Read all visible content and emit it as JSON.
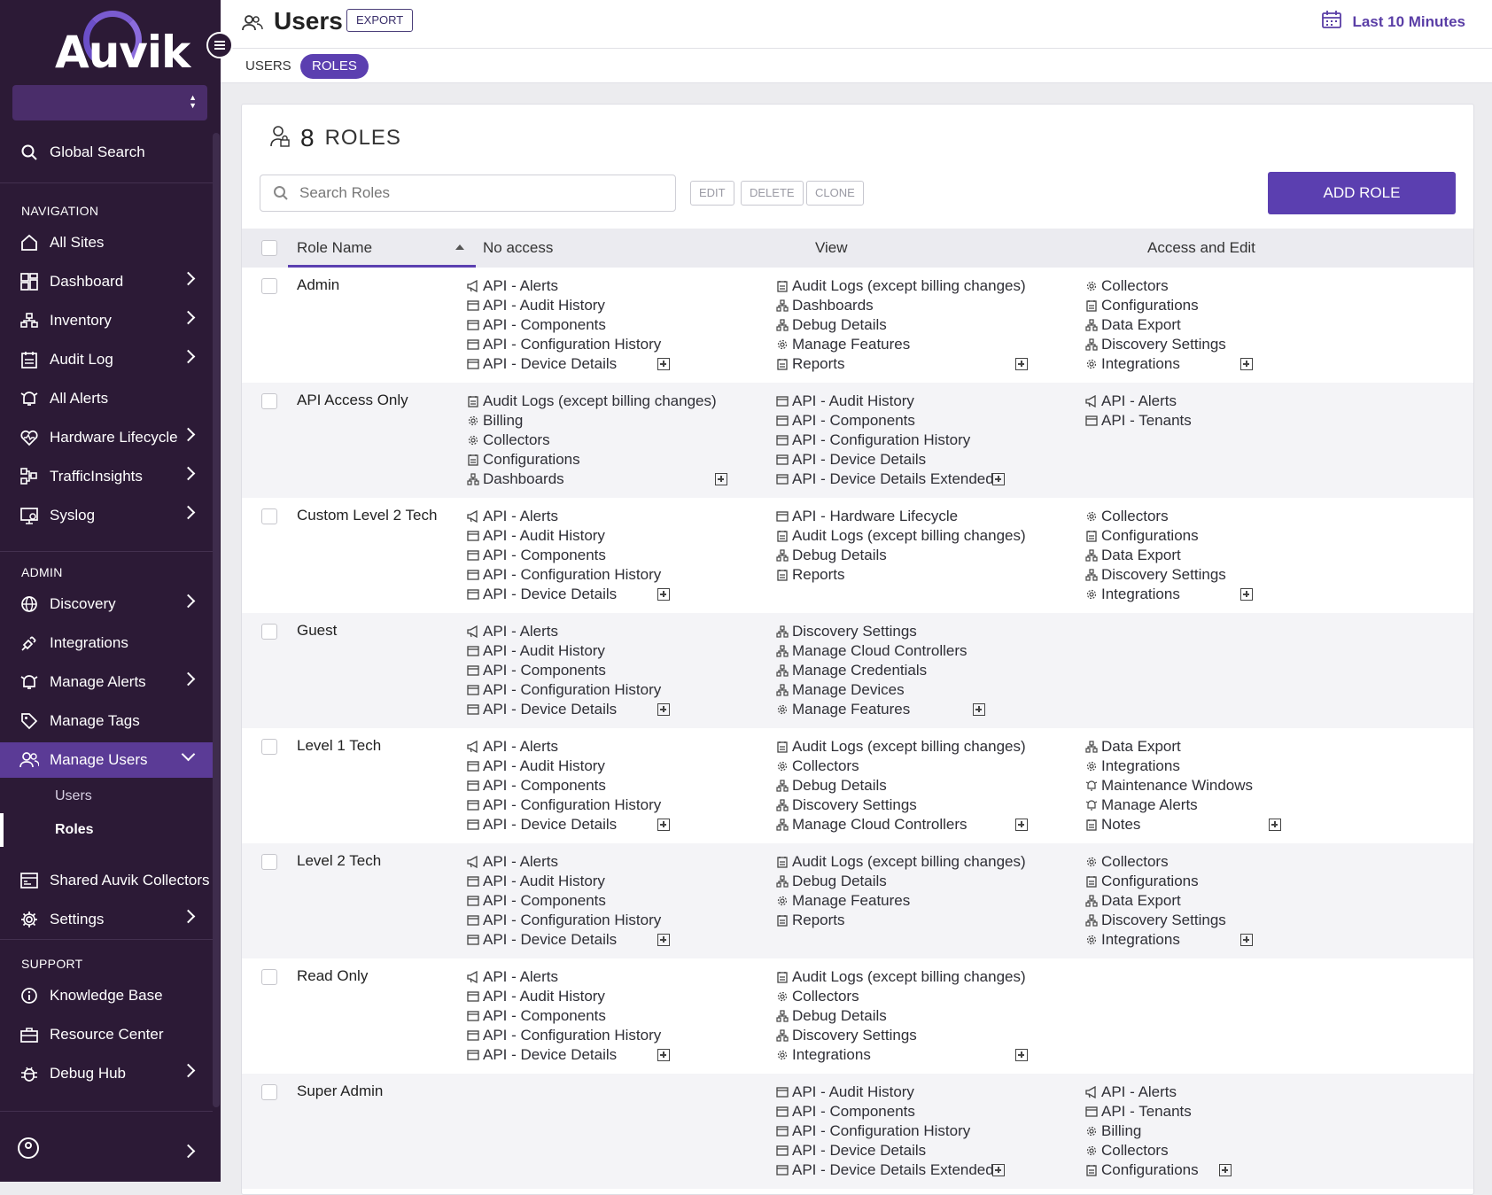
{
  "brand": {
    "name": "Auvik"
  },
  "sidebar": {
    "search_label": "Global Search",
    "nav_heading": "NAVIGATION",
    "admin_heading": "ADMIN",
    "support_heading": "SUPPORT",
    "nav_items": [
      {
        "label": "All Sites",
        "icon": "home-icon"
      },
      {
        "label": "Dashboard",
        "icon": "dashboard-icon"
      },
      {
        "label": "Inventory",
        "icon": "inventory-icon"
      },
      {
        "label": "Audit Log",
        "icon": "audit-log-icon"
      },
      {
        "label": "All Alerts",
        "icon": "alert-bell-icon"
      },
      {
        "label": "Hardware Lifecycle",
        "icon": "heart-icon"
      },
      {
        "label": "TrafficInsights",
        "icon": "traffic-icon"
      },
      {
        "label": "Syslog",
        "icon": "syslog-icon"
      }
    ],
    "admin_items": [
      {
        "label": "Discovery",
        "icon": "globe-icon"
      },
      {
        "label": "Integrations",
        "icon": "plug-icon"
      },
      {
        "label": "Manage Alerts",
        "icon": "alert-bell-icon"
      },
      {
        "label": "Manage Tags",
        "icon": "tag-icon"
      },
      {
        "label": "Manage Users",
        "icon": "users-icon"
      },
      {
        "label": "Shared Auvik Collectors",
        "icon": "collector-icon"
      },
      {
        "label": "Settings",
        "icon": "gear-icon"
      }
    ],
    "sub_items": [
      "Users",
      "Roles"
    ],
    "support_items": [
      {
        "label": "Knowledge Base",
        "icon": "info-icon"
      },
      {
        "label": "Resource Center",
        "icon": "briefcase-icon"
      },
      {
        "label": "Debug Hub",
        "icon": "bug-icon"
      }
    ]
  },
  "header": {
    "title": "Users",
    "export_label": "EXPORT",
    "time_range": "Last 10 Minutes",
    "tabs": [
      "USERS",
      "ROLES"
    ]
  },
  "roles": {
    "count": "8",
    "heading": "ROLES",
    "search_placeholder": "Search Roles",
    "edit_label": "EDIT",
    "delete_label": "DELETE",
    "clone_label": "CLONE",
    "add_label": "ADD ROLE",
    "columns": [
      "Role Name",
      "No access",
      "View",
      "Access and Edit"
    ],
    "rows": [
      {
        "name": "Admin",
        "no_access": [
          [
            "API - Alerts",
            "megaphone"
          ],
          [
            "API - Audit History",
            "window"
          ],
          [
            "API - Components",
            "window"
          ],
          [
            "API - Configuration History",
            "window"
          ],
          [
            "API - Device Details",
            "window"
          ]
        ],
        "view": [
          [
            "Audit Logs (except billing changes)",
            "log"
          ],
          [
            "Dashboards",
            "network"
          ],
          [
            "Debug Details",
            "network"
          ],
          [
            "Manage Features",
            "gear"
          ],
          [
            "Reports",
            "log"
          ]
        ],
        "edit": [
          [
            "Collectors",
            "gear"
          ],
          [
            "Configurations",
            "log"
          ],
          [
            "Data Export",
            "network"
          ],
          [
            "Discovery Settings",
            "network"
          ],
          [
            "Integrations",
            "gear"
          ]
        ]
      },
      {
        "name": "API Access Only",
        "no_access": [
          [
            "Audit Logs (except billing changes)",
            "log"
          ],
          [
            "Billing",
            "gear"
          ],
          [
            "Collectors",
            "gear"
          ],
          [
            "Configurations",
            "log"
          ],
          [
            "Dashboards",
            "network"
          ]
        ],
        "view": [
          [
            "API - Audit History",
            "window"
          ],
          [
            "API - Components",
            "window"
          ],
          [
            "API - Configuration History",
            "window"
          ],
          [
            "API - Device Details",
            "window"
          ],
          [
            "API - Device Details Extended",
            "window"
          ]
        ],
        "edit": [
          [
            "API - Alerts",
            "megaphone"
          ],
          [
            "API - Tenants",
            "window"
          ]
        ]
      },
      {
        "name": "Custom Level 2 Tech",
        "no_access": [
          [
            "API - Alerts",
            "megaphone"
          ],
          [
            "API - Audit History",
            "window"
          ],
          [
            "API - Components",
            "window"
          ],
          [
            "API - Configuration History",
            "window"
          ],
          [
            "API - Device Details",
            "window"
          ]
        ],
        "view": [
          [
            "API - Hardware Lifecycle",
            "window"
          ],
          [
            "Audit Logs (except billing changes)",
            "log"
          ],
          [
            "Debug Details",
            "network"
          ],
          [
            "Reports",
            "log"
          ]
        ],
        "edit": [
          [
            "Collectors",
            "gear"
          ],
          [
            "Configurations",
            "log"
          ],
          [
            "Data Export",
            "network"
          ],
          [
            "Discovery Settings",
            "network"
          ],
          [
            "Integrations",
            "gear"
          ]
        ]
      },
      {
        "name": "Guest",
        "no_access": [
          [
            "API - Alerts",
            "megaphone"
          ],
          [
            "API - Audit History",
            "window"
          ],
          [
            "API - Components",
            "window"
          ],
          [
            "API - Configuration History",
            "window"
          ],
          [
            "API - Device Details",
            "window"
          ]
        ],
        "view": [
          [
            "Discovery Settings",
            "network"
          ],
          [
            "Manage Cloud Controllers",
            "network"
          ],
          [
            "Manage Credentials",
            "network"
          ],
          [
            "Manage Devices",
            "network"
          ],
          [
            "Manage Features",
            "gear"
          ]
        ],
        "edit": []
      },
      {
        "name": "Level 1 Tech",
        "no_access": [
          [
            "API - Alerts",
            "megaphone"
          ],
          [
            "API - Audit History",
            "window"
          ],
          [
            "API - Components",
            "window"
          ],
          [
            "API - Configuration History",
            "window"
          ],
          [
            "API - Device Details",
            "window"
          ]
        ],
        "view": [
          [
            "Audit Logs (except billing changes)",
            "log"
          ],
          [
            "Collectors",
            "gear"
          ],
          [
            "Debug Details",
            "network"
          ],
          [
            "Discovery Settings",
            "network"
          ],
          [
            "Manage Cloud Controllers",
            "network"
          ]
        ],
        "edit": [
          [
            "Data Export",
            "network"
          ],
          [
            "Integrations",
            "gear"
          ],
          [
            "Maintenance Windows",
            "bell"
          ],
          [
            "Manage Alerts",
            "bell"
          ],
          [
            "Notes",
            "log"
          ]
        ]
      },
      {
        "name": "Level 2 Tech",
        "no_access": [
          [
            "API - Alerts",
            "megaphone"
          ],
          [
            "API - Audit History",
            "window"
          ],
          [
            "API - Components",
            "window"
          ],
          [
            "API - Configuration History",
            "window"
          ],
          [
            "API - Device Details",
            "window"
          ]
        ],
        "view": [
          [
            "Audit Logs (except billing changes)",
            "log"
          ],
          [
            "Debug Details",
            "network"
          ],
          [
            "Manage Features",
            "gear"
          ],
          [
            "Reports",
            "log"
          ]
        ],
        "edit": [
          [
            "Collectors",
            "gear"
          ],
          [
            "Configurations",
            "log"
          ],
          [
            "Data Export",
            "network"
          ],
          [
            "Discovery Settings",
            "network"
          ],
          [
            "Integrations",
            "gear"
          ]
        ]
      },
      {
        "name": "Read Only",
        "no_access": [
          [
            "API - Alerts",
            "megaphone"
          ],
          [
            "API - Audit History",
            "window"
          ],
          [
            "API - Components",
            "window"
          ],
          [
            "API - Configuration History",
            "window"
          ],
          [
            "API - Device Details",
            "window"
          ]
        ],
        "view": [
          [
            "Audit Logs (except billing changes)",
            "log"
          ],
          [
            "Collectors",
            "gear"
          ],
          [
            "Debug Details",
            "network"
          ],
          [
            "Discovery Settings",
            "network"
          ],
          [
            "Integrations",
            "gear"
          ]
        ],
        "edit": []
      },
      {
        "name": "Super Admin",
        "no_access": [],
        "view": [
          [
            "API - Audit History",
            "window"
          ],
          [
            "API - Components",
            "window"
          ],
          [
            "API - Configuration History",
            "window"
          ],
          [
            "API - Device Details",
            "window"
          ],
          [
            "API - Device Details Extended",
            "window"
          ]
        ],
        "edit": [
          [
            "API - Alerts",
            "megaphone"
          ],
          [
            "API - Tenants",
            "window"
          ],
          [
            "Billing",
            "gear"
          ],
          [
            "Collectors",
            "gear"
          ],
          [
            "Configurations",
            "log"
          ]
        ]
      }
    ]
  },
  "colors": {
    "accent": "#5b3fb0",
    "sidebar": "#2c1a36"
  }
}
